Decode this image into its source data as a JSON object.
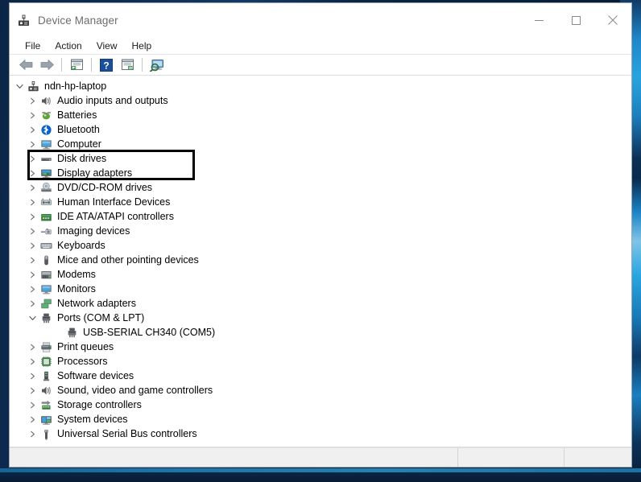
{
  "window": {
    "title": "Device Manager",
    "title_icon": "device-manager-icon",
    "controls": {
      "minimize": "minimize-icon",
      "maximize": "maximize-icon",
      "close": "close-icon"
    }
  },
  "menubar": {
    "items": [
      {
        "label": "File"
      },
      {
        "label": "Action"
      },
      {
        "label": "View"
      },
      {
        "label": "Help"
      }
    ]
  },
  "toolbar": {
    "buttons": [
      {
        "name": "back-arrow-icon",
        "tip": "Back"
      },
      {
        "name": "forward-arrow-icon",
        "tip": "Forward"
      },
      {
        "name": "separator-1",
        "tip": ""
      },
      {
        "name": "properties-window-icon",
        "tip": "Properties"
      },
      {
        "name": "separator-2",
        "tip": ""
      },
      {
        "name": "help-question-icon",
        "tip": "Help"
      },
      {
        "name": "update-driver-window-icon",
        "tip": "Update Driver Software"
      },
      {
        "name": "separator-3",
        "tip": ""
      },
      {
        "name": "scan-hardware-changes-icon",
        "tip": "Scan for hardware changes"
      }
    ]
  },
  "tree": {
    "root": {
      "label": "ndn-hp-laptop",
      "icon": "computer-root-icon",
      "expanded": true
    },
    "nodes": [
      {
        "label": "Audio inputs and outputs",
        "icon": "speaker-icon",
        "expanded": false,
        "depth": 1
      },
      {
        "label": "Batteries",
        "icon": "battery-icon",
        "expanded": false,
        "depth": 1
      },
      {
        "label": "Bluetooth",
        "icon": "bluetooth-icon",
        "expanded": false,
        "depth": 1
      },
      {
        "label": "Computer",
        "icon": "monitor-icon",
        "expanded": false,
        "depth": 1
      },
      {
        "label": "Disk drives",
        "icon": "disk-drive-icon",
        "expanded": false,
        "depth": 1
      },
      {
        "label": "Display adapters",
        "icon": "display-adapter-icon",
        "expanded": false,
        "depth": 1
      },
      {
        "label": "DVD/CD-ROM drives",
        "icon": "optical-drive-icon",
        "expanded": false,
        "depth": 1
      },
      {
        "label": "Human Interface Devices",
        "icon": "hid-icon",
        "expanded": false,
        "depth": 1
      },
      {
        "label": "IDE ATA/ATAPI controllers",
        "icon": "ide-controller-icon",
        "expanded": false,
        "depth": 1
      },
      {
        "label": "Imaging devices",
        "icon": "imaging-device-icon",
        "expanded": false,
        "depth": 1
      },
      {
        "label": "Keyboards",
        "icon": "keyboard-icon",
        "expanded": false,
        "depth": 1
      },
      {
        "label": "Mice and other pointing devices",
        "icon": "mouse-icon",
        "expanded": false,
        "depth": 1
      },
      {
        "label": "Modems",
        "icon": "modem-icon",
        "expanded": false,
        "depth": 1
      },
      {
        "label": "Monitors",
        "icon": "monitor-icon",
        "expanded": false,
        "depth": 1
      },
      {
        "label": "Network adapters",
        "icon": "network-adapter-icon",
        "expanded": false,
        "depth": 1
      },
      {
        "label": "Ports (COM & LPT)",
        "icon": "port-icon",
        "expanded": true,
        "depth": 1,
        "highlighted": true
      },
      {
        "label": "USB-SERIAL CH340 (COM5)",
        "icon": "port-icon",
        "expanded": null,
        "depth": 2,
        "highlighted": true
      },
      {
        "label": "Print queues",
        "icon": "printer-icon",
        "expanded": false,
        "depth": 1
      },
      {
        "label": "Processors",
        "icon": "processor-icon",
        "expanded": false,
        "depth": 1
      },
      {
        "label": "Software devices",
        "icon": "software-device-icon",
        "expanded": false,
        "depth": 1
      },
      {
        "label": "Sound, video and game controllers",
        "icon": "speaker-icon",
        "expanded": false,
        "depth": 1
      },
      {
        "label": "Storage controllers",
        "icon": "storage-controller-icon",
        "expanded": false,
        "depth": 1
      },
      {
        "label": "System devices",
        "icon": "system-device-icon",
        "expanded": false,
        "depth": 1
      },
      {
        "label": "Universal Serial Bus controllers",
        "icon": "usb-icon",
        "expanded": false,
        "depth": 1
      }
    ]
  },
  "statusbar": {
    "main": "",
    "cell2": "",
    "cell3": ""
  },
  "colors": {
    "accent_blue": "#0063b1",
    "highlight_outline": "#000000",
    "window_bg": "#ffffff",
    "statusbar_bg": "#f0f0f0",
    "desktop_dark": "#0b2545",
    "desktop_cyan": "#29a4e0"
  }
}
